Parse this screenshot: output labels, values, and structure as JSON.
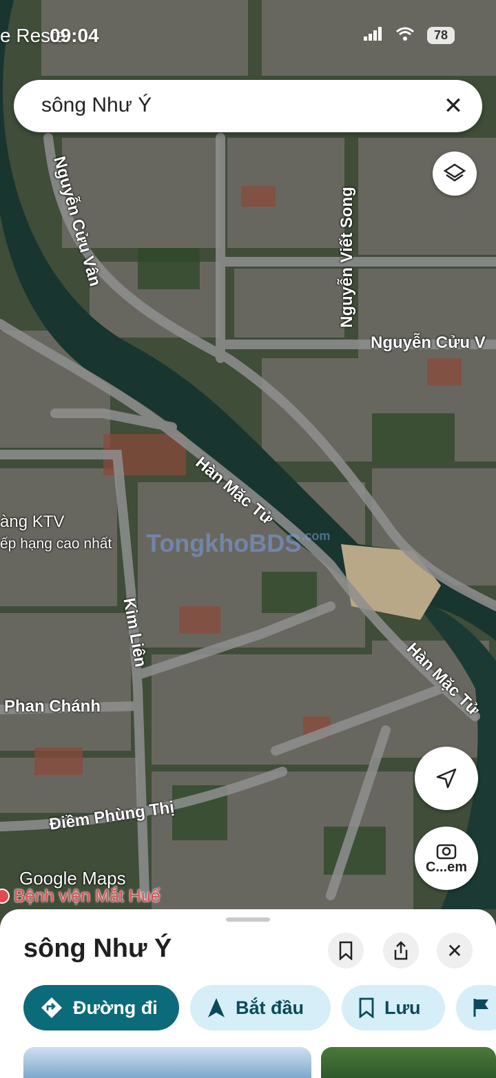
{
  "status_bar": {
    "back_label": "e Resta",
    "time": "09:04",
    "battery": "78"
  },
  "search": {
    "query": "sông Như Ý"
  },
  "map": {
    "street_labels": [
      "Nguyễn Cửu Vân",
      "Nguyễn Viết Song",
      "Nguyễn Cửu V",
      "Hàn Mặc Tử",
      "Kim Liên",
      "Hàn Mặc Tử",
      "Phan Chánh",
      "Điềm Phùng Thị"
    ],
    "poi_line1": "àng KTV",
    "poi_line2": "ếp hạng cao nhất",
    "watermark": "TongkhoBDS",
    "watermark_suffix": ".com",
    "attribution": "Google Maps",
    "hospital": "Bệnh viện Mắt Huế",
    "camera_label": "C...em"
  },
  "sheet": {
    "title": "sông Như Ý",
    "actions": [
      {
        "label": "Đường đi",
        "icon": "directions-icon"
      },
      {
        "label": "Bắt đầu",
        "icon": "navigation-arrow-icon"
      },
      {
        "label": "Lưu",
        "icon": "bookmark-icon"
      }
    ]
  },
  "colors": {
    "accent": "#0b6b7a",
    "chip_bg": "#d5eef8",
    "river": "#18352f"
  }
}
